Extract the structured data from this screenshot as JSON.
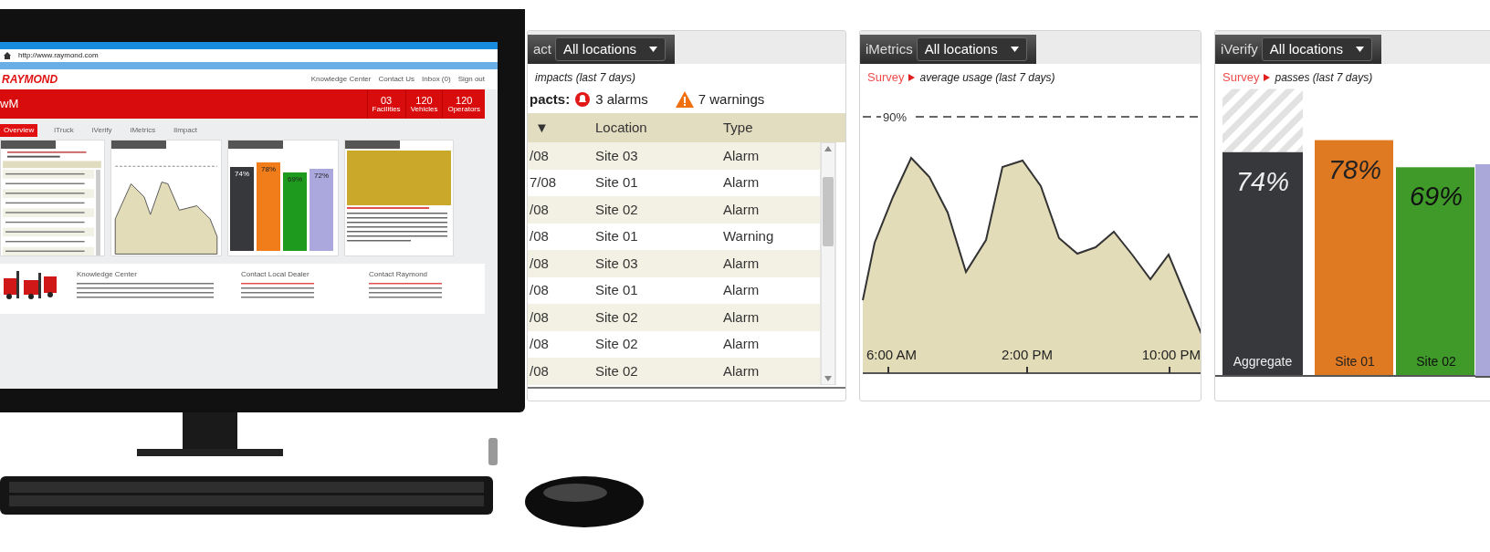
{
  "monitor": {
    "address": "http://www.raymond.com",
    "logo": "RAYMOND",
    "links": [
      "Knowledge Center",
      "Contact Us",
      "Inbox (0)",
      "Sign out"
    ],
    "title": "wM",
    "stats": [
      {
        "value": "03",
        "label": "Facilities"
      },
      {
        "value": "120",
        "label": "Vehicles"
      },
      {
        "value": "120",
        "label": "Operators"
      }
    ],
    "tabs": [
      {
        "label": "Overview",
        "selected": true
      },
      {
        "label": "iTruck",
        "selected": false
      },
      {
        "label": "iVerify",
        "selected": false
      },
      {
        "label": "iMetrics",
        "selected": false
      },
      {
        "label": "iImpact",
        "selected": false
      }
    ],
    "mini_bars": [
      {
        "value": "74%",
        "color": "#36383c"
      },
      {
        "value": "78%",
        "color": "#f07c1a"
      },
      {
        "value": "69%",
        "color": "#1e9a1e"
      },
      {
        "value": "72%",
        "color": "#aaa8dc"
      }
    ],
    "footer": [
      "Knowledge Center",
      "Contact Local Dealer",
      "Contact Raymond"
    ]
  },
  "impacts": {
    "title": "act",
    "filter": "All locations",
    "subtitle": "impacts (last 7 days)",
    "summary_label": "pacts:",
    "alarms": "3 alarms",
    "warnings": "7 warnings",
    "columns": [
      "▼",
      "Location",
      "Type"
    ],
    "rows": [
      {
        "date": "/08",
        "location": "Site 03",
        "type": "Alarm"
      },
      {
        "date": "7/08",
        "location": "Site 01",
        "type": "Alarm"
      },
      {
        "date": "/08",
        "location": "Site 02",
        "type": "Alarm"
      },
      {
        "date": "/08",
        "location": "Site 01",
        "type": "Warning"
      },
      {
        "date": "/08",
        "location": "Site 03",
        "type": "Alarm"
      },
      {
        "date": "/08",
        "location": "Site 01",
        "type": "Alarm"
      },
      {
        "date": "/08",
        "location": "Site 02",
        "type": "Alarm"
      },
      {
        "date": "/08",
        "location": "Site 02",
        "type": "Alarm"
      },
      {
        "date": "/08",
        "location": "Site 02",
        "type": "Alarm"
      }
    ]
  },
  "metrics": {
    "title": "iMetrics",
    "filter": "All locations",
    "breadcrumb": "Survey",
    "subtitle": "average usage (last 7 days)",
    "threshold": "90%",
    "x_labels": [
      "6:00 AM",
      "2:00 PM",
      "10:00 PM"
    ]
  },
  "verify": {
    "title": "iVerify",
    "filter": "All locations",
    "breadcrumb": "Survey",
    "subtitle": "passes (last 7 days)",
    "chart_data": {
      "type": "bar",
      "categories": [
        "Aggregate",
        "Site 01",
        "Site 02"
      ],
      "values": [
        74,
        78,
        69
      ],
      "value_labels": [
        "74%",
        "78%",
        "69%"
      ]
    }
  }
}
